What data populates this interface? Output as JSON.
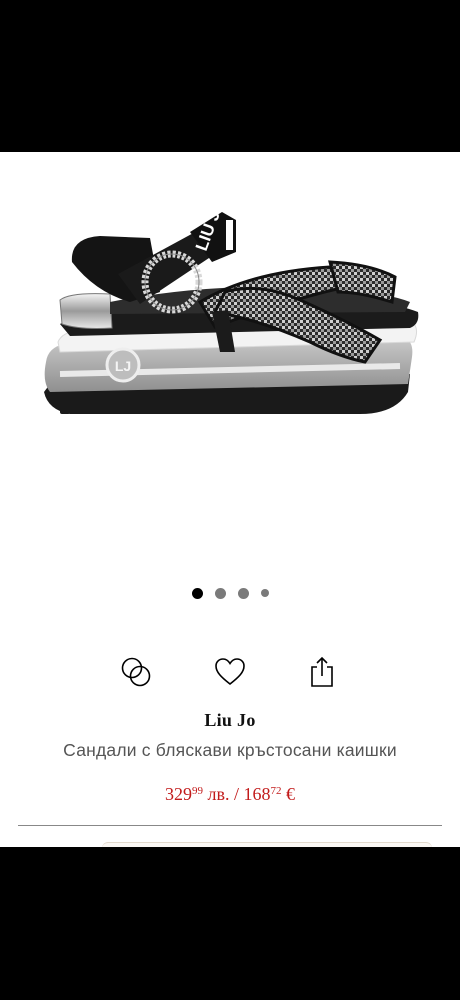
{
  "product": {
    "brand": "Liu Jo",
    "name": "Сандали с бляскави кръстосани каишки",
    "price_main_int": "329",
    "price_main_dec": "99",
    "price_main_currency": " лв. / ",
    "price_alt_int": "168",
    "price_alt_dec": "72",
    "price_alt_currency": " €"
  },
  "image": {
    "strap_logo": "LIU JO",
    "heel_logo": "LJ"
  },
  "carousel": {
    "count": 4,
    "active_index": 0
  },
  "actions": [
    {
      "icon": "compare-icon"
    },
    {
      "icon": "heart-icon"
    },
    {
      "icon": "share-icon"
    }
  ],
  "colors": {
    "price": "#c21b1b",
    "background": "#ffffff",
    "frame": "#000000"
  }
}
